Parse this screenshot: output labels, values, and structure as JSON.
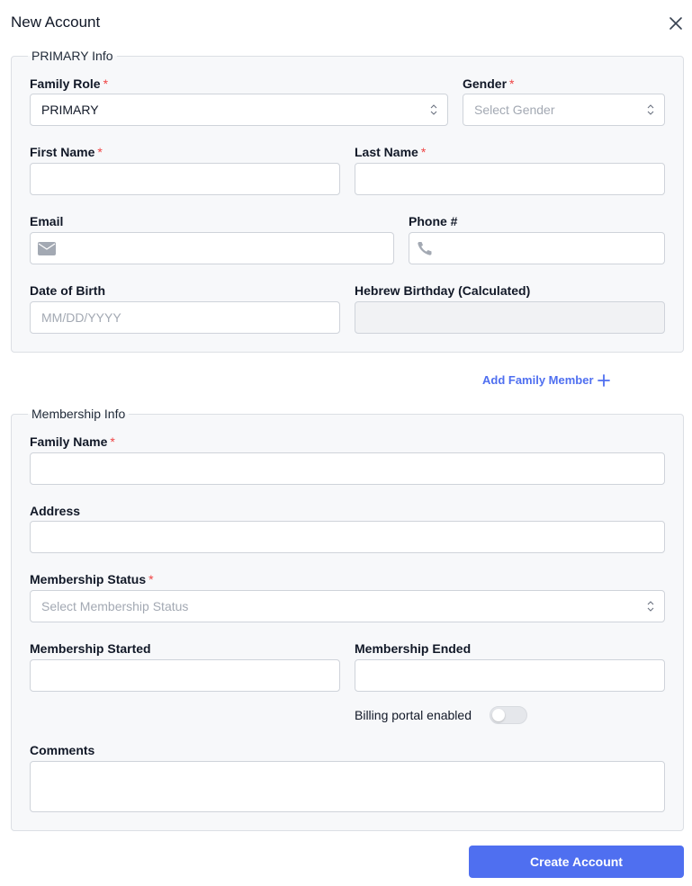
{
  "modal": {
    "title": "New Account",
    "close_icon": "close-icon"
  },
  "primary_info": {
    "legend": "PRIMARY Info",
    "family_role": {
      "label": "Family Role",
      "required": "*",
      "value": "PRIMARY"
    },
    "gender": {
      "label": "Gender",
      "required": "*",
      "placeholder": "Select Gender"
    },
    "first_name": {
      "label": "First Name",
      "required": "*",
      "value": ""
    },
    "last_name": {
      "label": "Last Name",
      "required": "*",
      "value": ""
    },
    "email": {
      "label": "Email",
      "value": "",
      "icon": "mail-icon"
    },
    "phone": {
      "label": "Phone #",
      "value": "",
      "icon": "phone-icon"
    },
    "dob": {
      "label": "Date of Birth",
      "placeholder": "MM/DD/YYYY"
    },
    "hebrew_birthday": {
      "label": "Hebrew Birthday (Calculated)",
      "value": ""
    }
  },
  "add_family_member": {
    "label": "Add Family Member",
    "icon": "plus-icon"
  },
  "membership_info": {
    "legend": "Membership Info",
    "family_name": {
      "label": "Family Name",
      "required": "*",
      "value": ""
    },
    "address": {
      "label": "Address",
      "value": ""
    },
    "status": {
      "label": "Membership Status",
      "required": "*",
      "placeholder": "Select Membership Status"
    },
    "started": {
      "label": "Membership Started",
      "value": ""
    },
    "ended": {
      "label": "Membership Ended",
      "value": ""
    },
    "billing_portal": {
      "label": "Billing portal enabled",
      "enabled": false
    },
    "comments": {
      "label": "Comments",
      "value": ""
    }
  },
  "actions": {
    "create_label": "Create Account"
  },
  "colors": {
    "accent": "#4f6ff0",
    "required": "#ef4444"
  }
}
